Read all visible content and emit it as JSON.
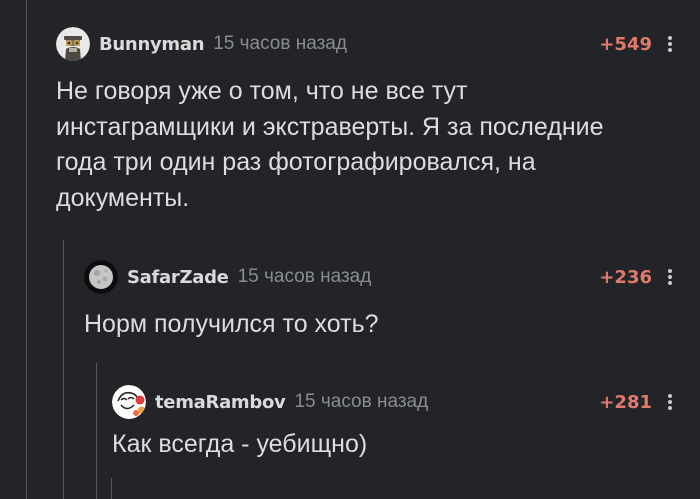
{
  "comments": [
    {
      "username": "Bunnyman",
      "time": "15 часов назад",
      "rating": "+549",
      "avatar_icon": "bunnyman-avatar-icon",
      "text_lines": [
        "Не говоря уже о том, что не все тут",
        "инстаграмщики и экстраверты. Я за последние",
        "года три один раз фотографировался, на",
        "документы."
      ]
    },
    {
      "username": "SafarZade",
      "time": "15 часов назад",
      "rating": "+236",
      "avatar_icon": "moon-avatar-icon",
      "text_lines": [
        "Норм получился то хоть?"
      ]
    },
    {
      "username": "temaRambov",
      "time": "15 часов назад",
      "rating": "+281",
      "avatar_icon": "meme-face-avatar-icon",
      "text_lines": [
        "Как всегда - уебищно)"
      ]
    }
  ],
  "colors": {
    "background": "#232427",
    "rating": "#df7a6c",
    "thread_line": "#53565a"
  }
}
